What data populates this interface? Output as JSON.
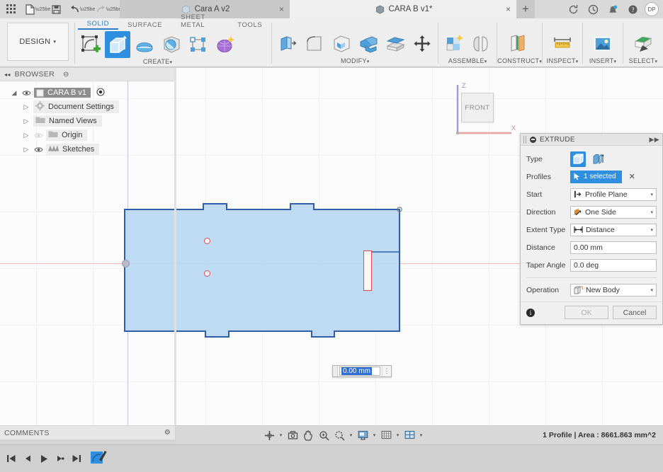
{
  "titlebar": {
    "quick_access": [
      {
        "name": "grid-apps-icon",
        "label": "Show Data Panel"
      },
      {
        "name": "file-icon",
        "label": "File"
      },
      {
        "name": "save-icon",
        "label": "Save"
      },
      {
        "name": "undo-icon",
        "label": "Undo"
      },
      {
        "name": "redo-icon",
        "label": "Redo"
      }
    ],
    "tabs": [
      {
        "label": "Cara A v2",
        "active": false,
        "close": "×"
      },
      {
        "label": "CARA B v1*",
        "active": true,
        "close": "×"
      }
    ],
    "add_tab": "+",
    "right_icons": [
      {
        "name": "refresh-icon"
      },
      {
        "name": "recent-icon"
      },
      {
        "name": "notifications-icon"
      },
      {
        "name": "help-icon"
      }
    ],
    "avatar_initials": "DP"
  },
  "ribbon": {
    "workspace_label": "DESIGN",
    "workspace_caret": "▾",
    "tabs": [
      {
        "label": "SOLID",
        "selected": true
      },
      {
        "label": "SURFACE",
        "selected": false
      },
      {
        "label": "SHEET METAL",
        "selected": false
      },
      {
        "label": "TOOLS",
        "selected": false
      }
    ],
    "groups": [
      {
        "label": "CREATE",
        "caret": "▾",
        "items": [
          {
            "name": "create-sketch-icon",
            "label": "Create Sketch",
            "active": false
          },
          {
            "name": "extrude-icon",
            "label": "Extrude",
            "active": true
          },
          {
            "name": "revolve-icon",
            "label": "Revolve",
            "active": false
          },
          {
            "name": "sphere-icon",
            "label": "Sphere",
            "active": false
          },
          {
            "name": "pattern-icon",
            "label": "Pattern",
            "active": false
          },
          {
            "name": "form-icon",
            "label": "Create Form",
            "active": false
          }
        ]
      },
      {
        "label": "MODIFY",
        "caret": "▾",
        "items": [
          {
            "name": "press-pull-icon",
            "label": "Press Pull",
            "active": false
          },
          {
            "name": "fillet-icon",
            "label": "Fillet",
            "active": false
          },
          {
            "name": "shell-icon",
            "label": "Shell",
            "active": false
          },
          {
            "name": "combine-icon",
            "label": "Combine",
            "active": false
          },
          {
            "name": "offset-face-icon",
            "label": "Offset Face",
            "active": false
          },
          {
            "name": "move-copy-icon",
            "label": "Move/Copy",
            "active": false
          }
        ]
      },
      {
        "label": "ASSEMBLE",
        "caret": "▾",
        "items": [
          {
            "name": "new-component-icon",
            "label": "New Component",
            "active": false
          },
          {
            "name": "joint-icon",
            "label": "Joint",
            "active": false
          }
        ]
      },
      {
        "label": "CONSTRUCT",
        "caret": "▾",
        "items": [
          {
            "name": "offset-plane-icon",
            "label": "Offset Plane",
            "active": false
          }
        ]
      },
      {
        "label": "INSPECT",
        "caret": "▾",
        "items": [
          {
            "name": "measure-icon",
            "label": "Measure",
            "active": false
          }
        ]
      },
      {
        "label": "INSERT",
        "caret": "▾",
        "items": [
          {
            "name": "insert-image-icon",
            "label": "Insert Image",
            "active": false
          }
        ]
      },
      {
        "label": "SELECT",
        "caret": "▾",
        "items": [
          {
            "name": "select-icon",
            "label": "Select",
            "active": false
          }
        ]
      }
    ]
  },
  "browser": {
    "title": "BROWSER",
    "collapse_icon": "◂◂",
    "settings_icon": "⊖",
    "root": {
      "label": "CARA B v1",
      "arrow": "◢",
      "eye": "visible"
    },
    "items": [
      {
        "label": "Document Settings",
        "arrow": "▷",
        "icon": "gear-icon",
        "eye": false,
        "dim": false
      },
      {
        "label": "Named Views",
        "arrow": "▷",
        "icon": "folder-icon",
        "eye": false,
        "dim": false
      },
      {
        "label": "Origin",
        "arrow": "▷",
        "icon": "folder-icon",
        "eye": true,
        "dim": true
      },
      {
        "label": "Sketches",
        "arrow": "▷",
        "icon": "sketches-icon",
        "eye": true,
        "dim": false
      }
    ]
  },
  "canvas": {
    "viewcube": {
      "face_label": "FRONT",
      "axis_z": "Z",
      "axis_x": "X"
    },
    "inline_input": {
      "value": "0.00 mm",
      "menu_icon": "⋮"
    },
    "holes_count": 2
  },
  "extrude": {
    "title": "EXTRUDE",
    "rows": {
      "type_label": "Type",
      "type_options": [
        {
          "name": "solid-extrude-icon",
          "selected": true
        },
        {
          "name": "thin-extrude-icon",
          "selected": false
        }
      ],
      "profiles_label": "Profiles",
      "profiles_value": "1 selected",
      "profiles_clear": "✕",
      "start_label": "Start",
      "start_value": "Profile Plane",
      "direction_label": "Direction",
      "direction_value": "One Side",
      "extent_type_label": "Extent Type",
      "extent_type_value": "Distance",
      "distance_label": "Distance",
      "distance_value": "0.00 mm",
      "taper_label": "Taper Angle",
      "taper_value": "0.0 deg",
      "operation_label": "Operation",
      "operation_value": "New Body"
    },
    "caret": "▾",
    "info_icon": "i",
    "ok_label": "OK",
    "cancel_label": "Cancel"
  },
  "bottom": {
    "comments_label": "COMMENTS",
    "comments_settings_icon": "⚙",
    "nav_tools": [
      {
        "name": "orbit-icon",
        "caret": true
      },
      {
        "name": "look-at-icon",
        "caret": false
      },
      {
        "name": "pan-icon",
        "caret": false
      },
      {
        "name": "zoom-icon",
        "caret": false
      },
      {
        "name": "zoom-window-icon",
        "caret": true
      },
      {
        "name": "display-settings-icon",
        "caret": true
      },
      {
        "name": "grid-snaps-icon",
        "caret": true
      },
      {
        "name": "viewports-icon",
        "caret": true
      }
    ],
    "status_text": "1 Profile | Area : 8661.863 mm^2",
    "timeline_buttons": [
      {
        "name": "timeline-first-icon",
        "glyph": "⏮"
      },
      {
        "name": "timeline-prev-icon",
        "glyph": "◀"
      },
      {
        "name": "timeline-play-icon",
        "glyph": "▶"
      },
      {
        "name": "timeline-next-icon",
        "glyph": "▶"
      },
      {
        "name": "timeline-last-icon",
        "glyph": "⏭"
      }
    ],
    "timeline_feature": {
      "name": "timeline-sketch-feature",
      "label": "Sketch1"
    }
  }
}
